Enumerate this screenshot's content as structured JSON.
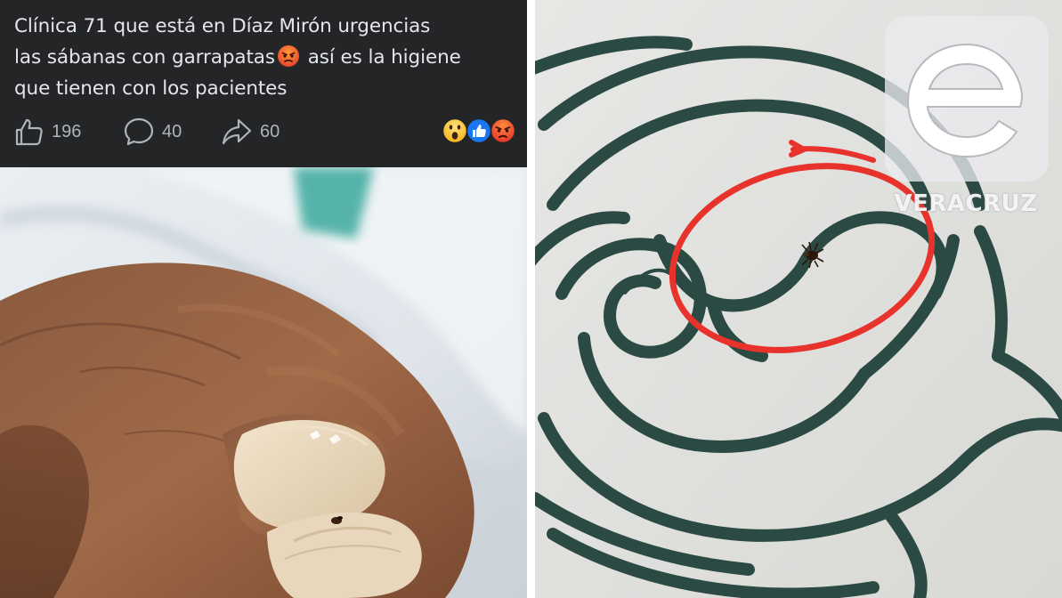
{
  "post": {
    "text_lines": [
      "Clínica 71 que está en Díaz Mirón urgencias",
      "las sábanas con garrapatas",
      "así es la higiene",
      "que tienen con los pacientes"
    ],
    "like_count": "196",
    "comment_count": "40",
    "share_count": "60",
    "reaction_icons": [
      "wow-reaction",
      "like-reaction",
      "angry-reaction"
    ],
    "colors": {
      "background": "#242526",
      "text": "#e4e6eb",
      "muted": "#b0b3b8"
    }
  },
  "left_photo": {
    "subject": "finger-holding-tick"
  },
  "right_photo": {
    "subject": "bedsheet-with-tick",
    "marker_color": "#e8332c"
  },
  "watermark": {
    "wordmark": "VERACRUZ",
    "logo_letter": "e"
  }
}
